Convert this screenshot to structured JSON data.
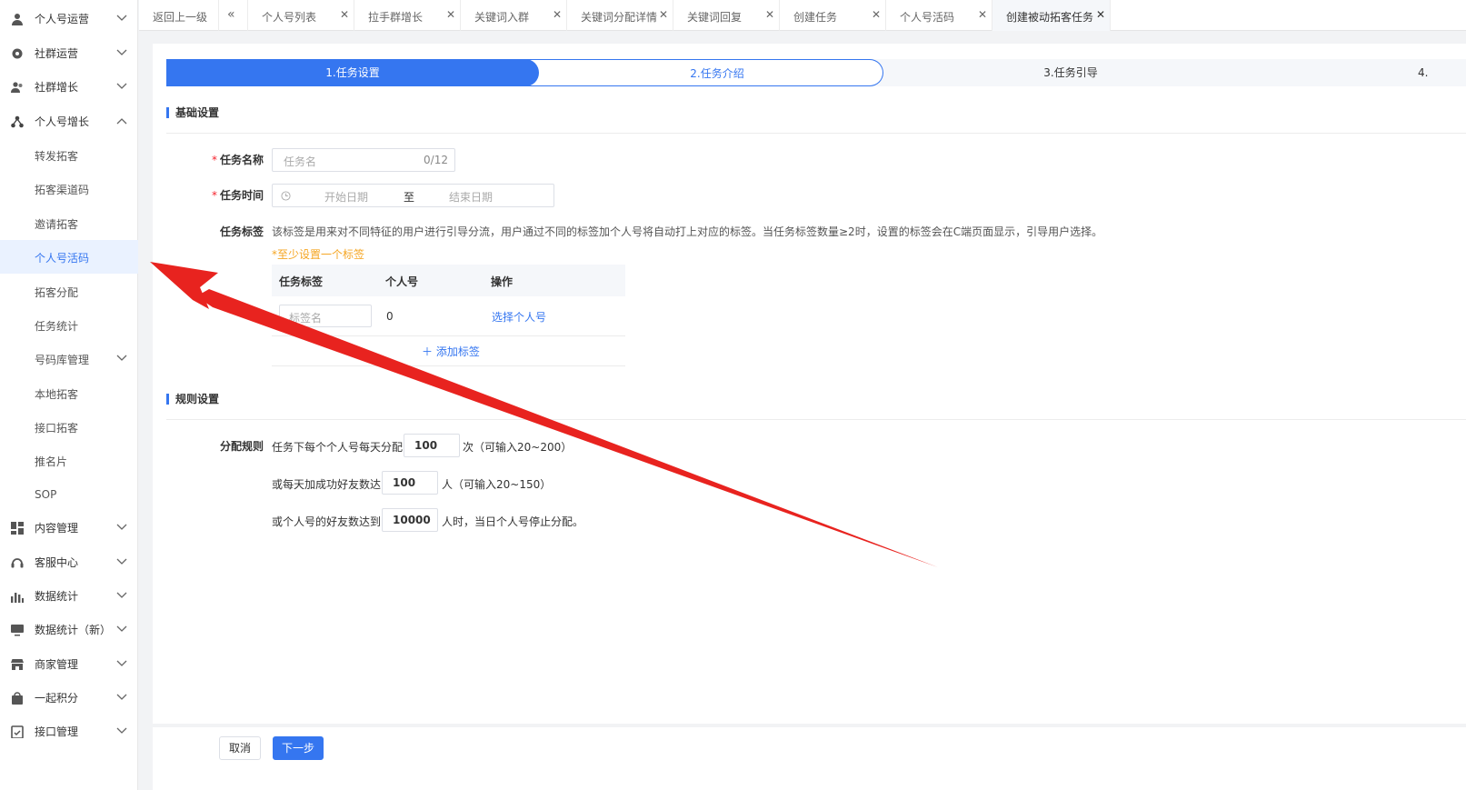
{
  "sidebar": {
    "menu": [
      {
        "label": "个人号运营",
        "icon": "user-icon"
      },
      {
        "label": "社群运营",
        "icon": "gear-icon"
      },
      {
        "label": "社群增长",
        "icon": "users-icon"
      },
      {
        "label": "个人号增长",
        "icon": "network-icon"
      }
    ],
    "sub": [
      "转发拓客",
      "拓客渠道码",
      "邀请拓客",
      "个人号活码",
      "拓客分配",
      "任务统计",
      "号码库管理",
      "本地拓客",
      "接口拓客",
      "推名片",
      "SOP"
    ],
    "menu2": [
      {
        "label": "内容管理",
        "icon": "grid-icon"
      },
      {
        "label": "客服中心",
        "icon": "headset-icon"
      },
      {
        "label": "数据统计",
        "icon": "bar-chart-icon"
      },
      {
        "label": "数据统计（新）",
        "icon": "monitor-icon"
      },
      {
        "label": "商家管理",
        "icon": "store-icon"
      },
      {
        "label": "一起积分",
        "icon": "bag-icon"
      },
      {
        "label": "接口管理",
        "icon": "clipboard-icon"
      }
    ]
  },
  "tabs": [
    "返回上一级",
    "个人号列表",
    "拉手群增长",
    "关键词入群",
    "关键词分配详情",
    "关键词回复",
    "创建任务",
    "个人号活码",
    "创建被动拓客任务"
  ],
  "steps": [
    "1.任务设置",
    "2.任务介绍",
    "3.任务引导",
    "4."
  ],
  "basic": {
    "title": "基础设置",
    "name_label": "任务名称",
    "name_placeholder": "任务名",
    "name_count": "0/12",
    "time_label": "任务时间",
    "start_placeholder": "开始日期",
    "to": "至",
    "end_placeholder": "结束日期",
    "tag_label": "任务标签",
    "tag_desc": "该标签是用来对不同特征的用户进行引导分流，用户通过不同的标签加个人号将自动打上对应的标签。当任务标签数量≥2时，设置的标签会在C端页面显示，引导用户选择。",
    "tag_warn": "*至少设置一个标签",
    "table_headers": [
      "任务标签",
      "个人号",
      "操作"
    ],
    "row": {
      "tag_placeholder": "标签名",
      "count": "0",
      "action": "选择个人号"
    },
    "add_tag": "＋ 添加标签"
  },
  "rules": {
    "title": "规则设置",
    "label": "分配规则",
    "line1_pre": "任务下每个个人号每天分配",
    "line1_val": "100",
    "line1_post": "次（可输入20~200）",
    "line2_pre": "或每天加成功好友数达",
    "line2_val": "100",
    "line2_post": "人（可输入20~150）",
    "line3_pre": "或个人号的好友数达到",
    "line3_val": "10000",
    "line3_post": "人时，当日个人号停止分配。"
  },
  "footer": {
    "cancel": "取消",
    "next": "下一步"
  },
  "colors": {
    "primary": "#3576f0",
    "arrow": "#e8231f",
    "warn": "#f5a623"
  }
}
